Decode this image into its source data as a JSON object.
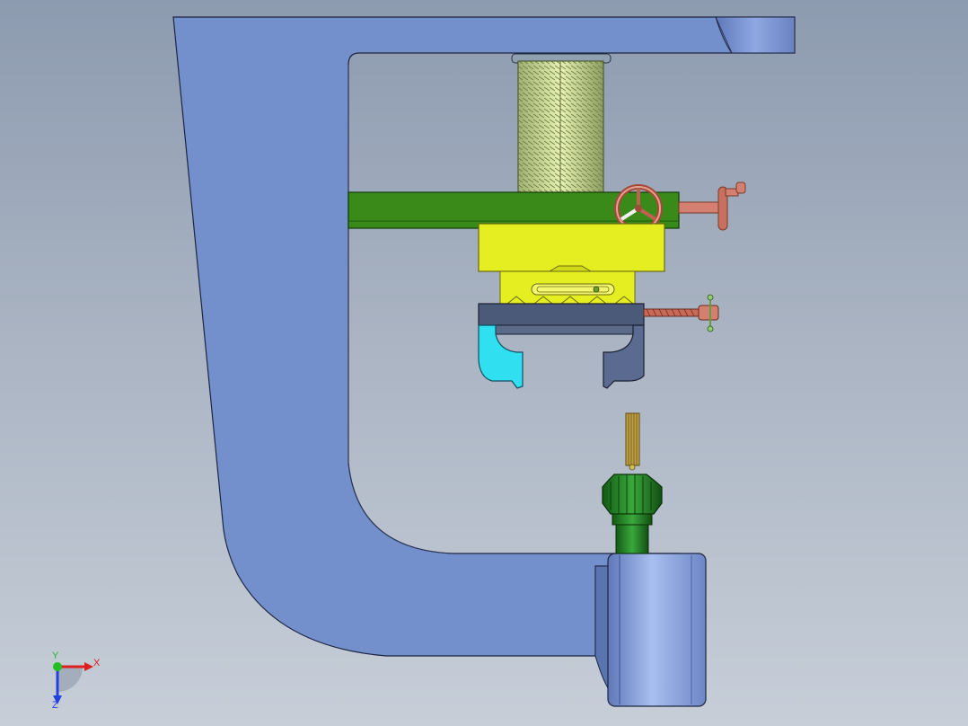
{
  "axes": {
    "x_label": "X",
    "y_label": "Y",
    "z_label": "Z",
    "x_color": "#e02020",
    "y_color": "#20c020",
    "z_color": "#2040e0"
  },
  "colors": {
    "background_top": "#8d9bb0",
    "background_bottom": "#c7ced8",
    "frame": "#7390cc",
    "frame_dark": "#5a74b0",
    "screw_thread": "#c9d890",
    "cross_rail": "#3a8a1a",
    "slide_block": "#e4ee20",
    "handwheel": "#d48070",
    "clamp_head": "#4c5a7a",
    "left_jaw": "#30e0f0",
    "right_jaw": "#5a6a90",
    "tool_holder": "#1f7a20",
    "brush": "#c0a040",
    "base_cylinder": "#8aa4e0"
  }
}
